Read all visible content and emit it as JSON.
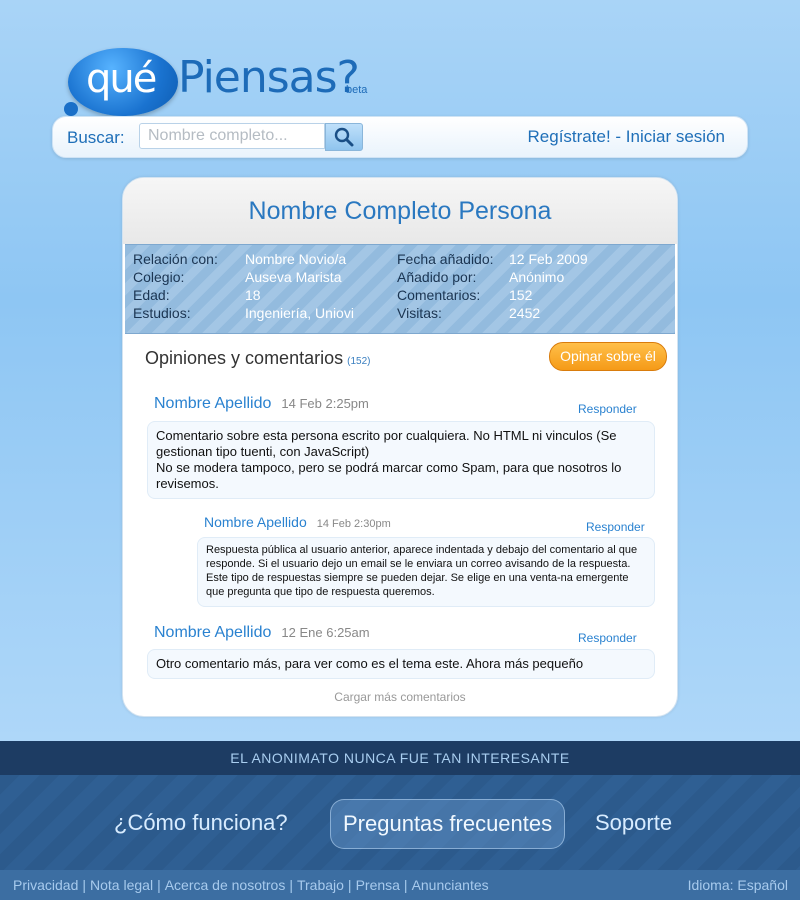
{
  "logo": {
    "que": "qué",
    "piensas": "Piensas?",
    "beta": "beta"
  },
  "search": {
    "label": "Buscar:",
    "placeholder": "Nombre completo..."
  },
  "auth": {
    "register": "Regístrate!",
    "separator": " - ",
    "login": "Iniciar sesión"
  },
  "profile": {
    "name": "Nombre Completo Persona",
    "info_left": [
      {
        "label": "Relación con:",
        "value": "Nombre Novio/a"
      },
      {
        "label": "Colegio:",
        "value": "Auseva Marista"
      },
      {
        "label": "Edad:",
        "value": "18"
      },
      {
        "label": "Estudios:",
        "value": "Ingeniería, Uniovi"
      }
    ],
    "info_right": [
      {
        "label": "Fecha añadido:",
        "value": "12 Feb 2009"
      },
      {
        "label": "Añadido por:",
        "value": "Anónimo"
      },
      {
        "label": "Comentarios:",
        "value": "152"
      },
      {
        "label": "Visitas:",
        "value": "2452"
      }
    ]
  },
  "comments_section": {
    "title": "Opiniones y comentarios",
    "count": "(152)",
    "opinar_label": "Opinar sobre él",
    "reply_label": "Responder",
    "load_more": "Cargar más comentarios",
    "comments": [
      {
        "author": "Nombre Apellido",
        "date": "14 Feb 2:25pm",
        "lines": [
          "Comentario sobre esta persona escrito por cualquiera. No HTML ni vinculos (Se gestionan tipo tuenti, con JavaScript)",
          "No se modera tampoco, pero se podrá marcar como Spam, para que nosotros lo revisemos."
        ]
      },
      {
        "author": "Nombre Apellido",
        "date": "14 Feb 2:30pm",
        "lines": [
          "Respuesta pública al usuario anterior, aparece indentada y debajo del comentario al que responde. Si el usuario dejo un email se le enviara un correo avisando de la respuesta. Este tipo de respuestas siempre se pueden dejar. Se elige en una venta-na emergente que pregunta que tipo de respuesta queremos."
        ]
      },
      {
        "author": "Nombre Apellido",
        "date": "12 Ene 6:25am",
        "lines": [
          "Otro comentario más, para ver como es el tema este. Ahora más pequeño"
        ]
      }
    ]
  },
  "footer": {
    "slogan": "EL ANONIMATO NUNCA FUE TAN INTERESANTE",
    "nav": [
      "¿Cómo funciona?",
      "Preguntas frecuentes",
      "Soporte"
    ],
    "links": [
      "Privacidad",
      "Nota legal",
      "Acerca de nosotros",
      "Trabajo",
      "Prensa",
      "Anunciantes"
    ],
    "link_separator": "|",
    "language": "Idioma: Español"
  },
  "colors": {
    "accent": "#2a78c0",
    "orange_button": "#f59a17",
    "footer_dark": "#1d3c63"
  },
  "icons": {
    "search": "magnifier-icon"
  }
}
